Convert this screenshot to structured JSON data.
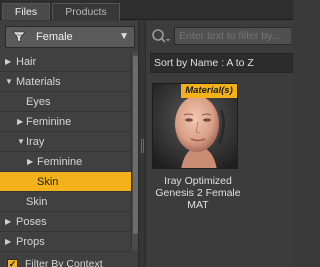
{
  "tabs": [
    {
      "label": "Files"
    },
    {
      "label": "Products"
    }
  ],
  "filter": {
    "label": "Female",
    "icon": "filter-icon"
  },
  "tree": [
    {
      "label": "Hair",
      "arrow": "right"
    },
    {
      "label": "Materials",
      "arrow": "down"
    },
    {
      "label": "Eyes"
    },
    {
      "label": "Feminine",
      "arrow": "right"
    },
    {
      "label": "Iray",
      "arrow": "down"
    },
    {
      "label": "Feminine",
      "arrow": "right"
    },
    {
      "label": "Skin",
      "selected": true
    },
    {
      "label": "Skin"
    },
    {
      "label": "Poses",
      "arrow": "right"
    },
    {
      "label": "Props",
      "arrow": "right"
    }
  ],
  "context": {
    "label": "Filter By Context",
    "checked": true
  },
  "search": {
    "placeholder": "Enter text to filter by..."
  },
  "sort": {
    "label": "Sort by Name : A to Z"
  },
  "item": {
    "badge": "Material(s)",
    "caption_lines": [
      "Iray Optimized",
      "Genesis 2 Female",
      "MAT"
    ]
  },
  "colors": {
    "accent": "#f3b21b",
    "panel": "#404040"
  }
}
